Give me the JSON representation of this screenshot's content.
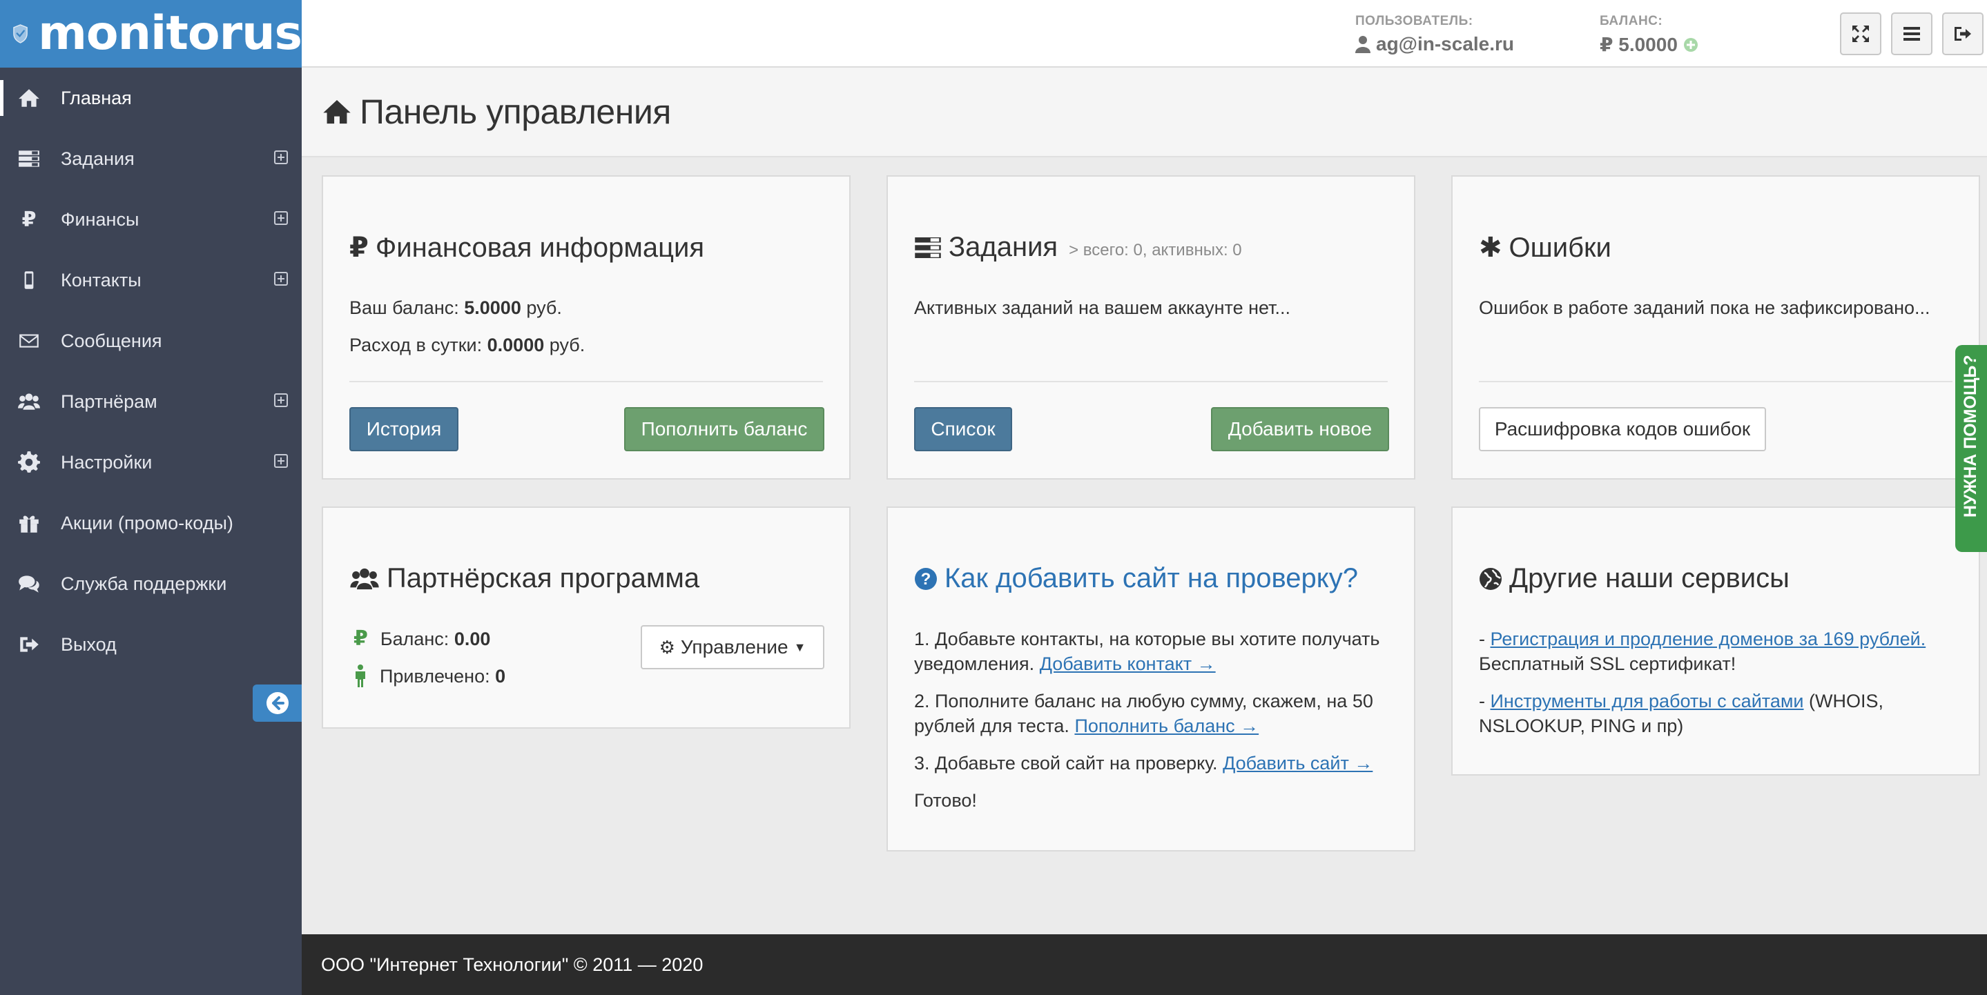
{
  "app": {
    "logo_text": "monitorus"
  },
  "sidebar": {
    "items": [
      {
        "label": "Главная",
        "icon": "home-icon"
      },
      {
        "label": "Задания",
        "icon": "tasks-icon"
      },
      {
        "label": "Финансы",
        "icon": "ruble-icon"
      },
      {
        "label": "Контакты",
        "icon": "mobile-icon"
      },
      {
        "label": "Сообщения",
        "icon": "envelope-icon"
      },
      {
        "label": "Партнёрам",
        "icon": "users-icon"
      },
      {
        "label": "Настройки",
        "icon": "gear-icon"
      },
      {
        "label": "Акции (промо-коды)",
        "icon": "gift-icon"
      },
      {
        "label": "Служба поддержки",
        "icon": "comments-icon"
      },
      {
        "label": "Выход",
        "icon": "sign-out-icon"
      }
    ]
  },
  "header": {
    "user_label": "ПОЛЬЗОВАТЕЛЬ:",
    "user_value": "ag@in-scale.ru",
    "balance_label": "БАЛАНС:",
    "balance_value": "₽ 5.0000"
  },
  "page": {
    "title": "Панель управления"
  },
  "finance": {
    "title": "Финансовая информация",
    "balance_label": "Ваш баланс:",
    "balance_value": "5.0000",
    "balance_unit": "руб.",
    "daily_label": "Расход в сутки:",
    "daily_value": "0.0000",
    "daily_unit": "руб.",
    "history_button": "История",
    "topup_button": "Пополнить баланс"
  },
  "tasks": {
    "title": "Задания",
    "subtitle": "> всего: 0, активных: 0",
    "text": "Активных заданий на вашем аккаунте нет...",
    "list_button": "Список",
    "add_button": "Добавить новое"
  },
  "errors": {
    "title": "Ошибки",
    "text": "Ошибок в работе заданий пока не зафиксировано...",
    "decode_button": "Расшифровка кодов ошибок"
  },
  "partner": {
    "title": "Партнёрская программа",
    "balance_label": "Баланс:",
    "balance_value": "0.00",
    "invited_label": "Привлечено:",
    "invited_value": "0",
    "manage_button": "Управление"
  },
  "howto": {
    "title": "Как добавить сайт на проверку?",
    "step1_text": "1. Добавьте контакты, на которые вы хотите получать уведомления.",
    "step1_link": "Добавить контакт →",
    "step2_text": "2. Пополните баланс на любую сумму, скажем, на 50 рублей для теста.",
    "step2_link": "Пополнить баланс →",
    "step3_text": "3. Добавьте свой сайт на проверку.",
    "step3_link": "Добавить сайт →",
    "done": "Готово!"
  },
  "services": {
    "title": "Другие наши сервисы",
    "item1_link": "Регистрация и продление доменов за 169 рублей.",
    "item1_text": "Бесплатный SSL сертификат!",
    "item2_link": "Инструменты для работы с сайтами",
    "item2_text": "(WHOIS, NSLOOKUP, PING и пр)"
  },
  "help_tab": "НУЖНА ПОМОЩЬ?",
  "footer": {
    "text": "ООО \"Интернет Технологии\" © 2011 — 2020"
  },
  "colors": {
    "sidebar": "#3d4455",
    "brand": "#3d86c4",
    "button_blue": "#4c7a9c",
    "button_green": "#6da06f",
    "help_green": "#3d9a4a"
  }
}
